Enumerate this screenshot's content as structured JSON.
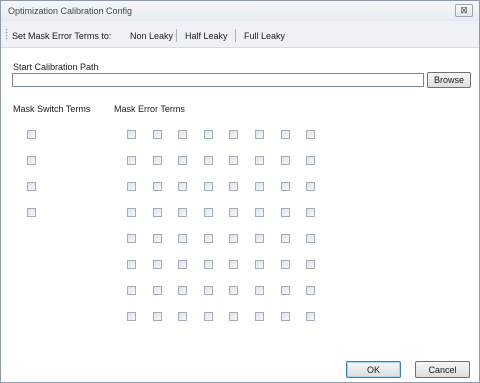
{
  "window": {
    "title": "Optimization Calibration Config",
    "close_glyph": "⊠",
    "close_icon": "close-icon"
  },
  "toolbar": {
    "label": "Set Mask Error Terms to:",
    "options": [
      "Non Leaky",
      "Half Leaky",
      "Full Leaky"
    ]
  },
  "path": {
    "label": "Start Calibration Path",
    "value": "",
    "browse_label": "Browse"
  },
  "mask_switch": {
    "label": "Mask Switch Terms",
    "rows": 4,
    "checked": [
      false,
      false,
      false,
      false
    ]
  },
  "mask_error": {
    "label": "Mask Error Terms",
    "rows": 8,
    "cols": 8,
    "all_checked": false
  },
  "buttons": {
    "ok": "OK",
    "cancel": "Cancel"
  }
}
